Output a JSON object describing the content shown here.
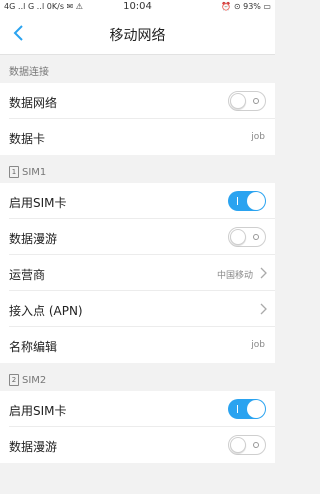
{
  "status_bar": {
    "left": "4G ‥l G ‥l 0K/s ✉ ⚠",
    "time": "10:04",
    "right": "⏰ ⊙ 93% ▭"
  },
  "nav": {
    "title": "移动网络"
  },
  "sections": {
    "data": {
      "header": "数据连接",
      "network_label": "数据网络",
      "network_on": false,
      "card_label": "数据卡",
      "card_value": "job"
    },
    "sim1": {
      "badge": "1",
      "header": "SIM1",
      "enable_label": "启用SIM卡",
      "enable_on": true,
      "roaming_label": "数据漫游",
      "roaming_on": false,
      "carrier_label": "运营商",
      "carrier_value": "中国移动",
      "apn_label": "接入点 (APN)",
      "name_label": "名称编辑",
      "name_value": "job"
    },
    "sim2": {
      "badge": "2",
      "header": "SIM2",
      "enable_label": "启用SIM卡",
      "enable_on": true,
      "roaming_label": "数据漫游",
      "roaming_on": false
    }
  },
  "colors": {
    "accent": "#2aa3f0",
    "background": "#f2f2f2"
  },
  "icons": {
    "back": "chevron-left-icon",
    "row_chevron": "chevron-right-icon"
  }
}
